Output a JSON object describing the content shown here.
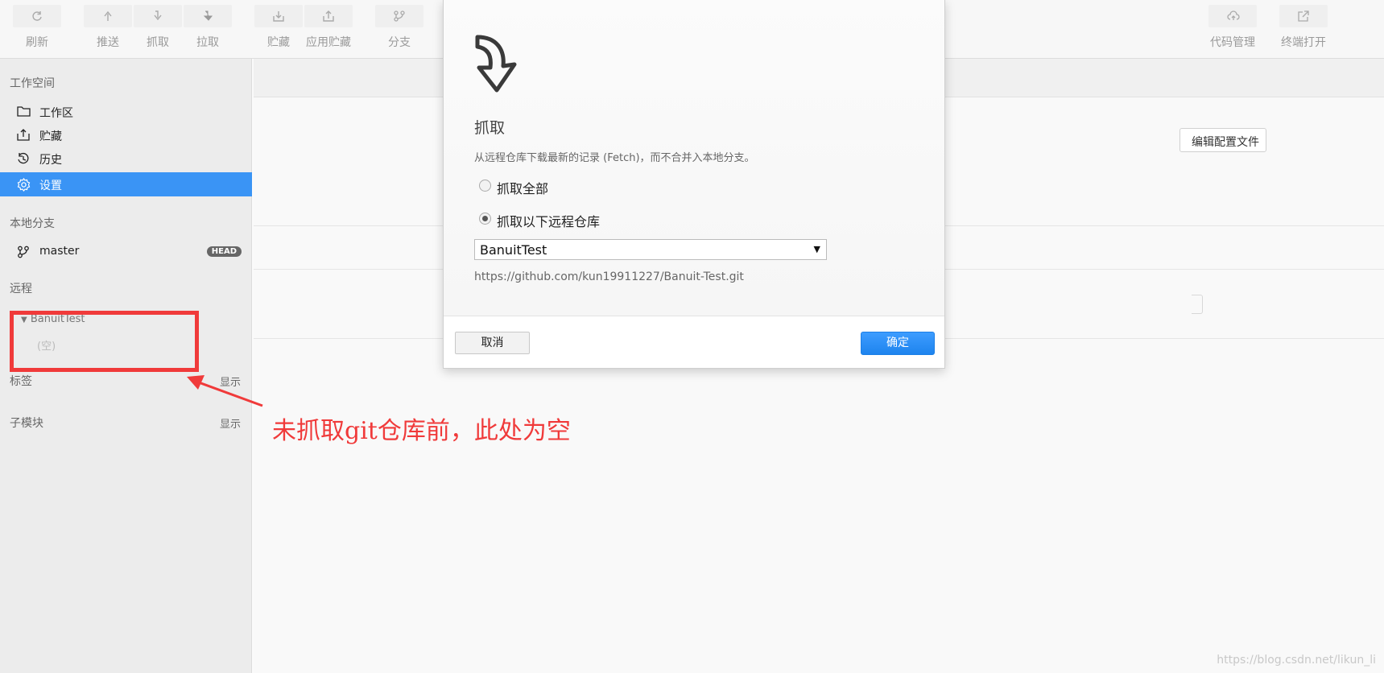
{
  "toolbar": {
    "refresh": "刷新",
    "push": "推送",
    "fetch": "抓取",
    "pull": "拉取",
    "stash": "贮藏",
    "apply_stash": "应用贮藏",
    "branch": "分支",
    "code_manage": "代码管理",
    "terminal_open": "终端打开"
  },
  "sidebar": {
    "workspace_title": "工作空间",
    "items": [
      {
        "label": "工作区"
      },
      {
        "label": "贮藏"
      },
      {
        "label": "历史"
      },
      {
        "label": "设置"
      }
    ],
    "local_branch_title": "本地分支",
    "branch_name": "master",
    "head_badge": "HEAD",
    "remote_title": "远程",
    "remote_name": "BanuitTest",
    "remote_empty": "(空)",
    "tags_title": "标签",
    "tags_show": "显示",
    "submodule_title": "子模块",
    "submodule_show": "显示"
  },
  "main": {
    "background_button": "编辑配置文件"
  },
  "dialog": {
    "title": "抓取",
    "description": "从远程仓库下载最新的记录 (Fetch)，而不合并入本地分支。",
    "option_all": "抓取全部",
    "option_selected": "抓取以下远程仓库",
    "selected_remote": "BanuitTest",
    "remote_url": "https://github.com/kun19911227/Banuit-Test.git",
    "cancel": "取消",
    "confirm": "确定"
  },
  "annotation": {
    "text": "未抓取git仓库前，此处为空"
  },
  "watermark": "https://blog.csdn.net/likun_li",
  "colors": {
    "accent": "#3a94f5",
    "annotation_red": "#f03a3a"
  }
}
